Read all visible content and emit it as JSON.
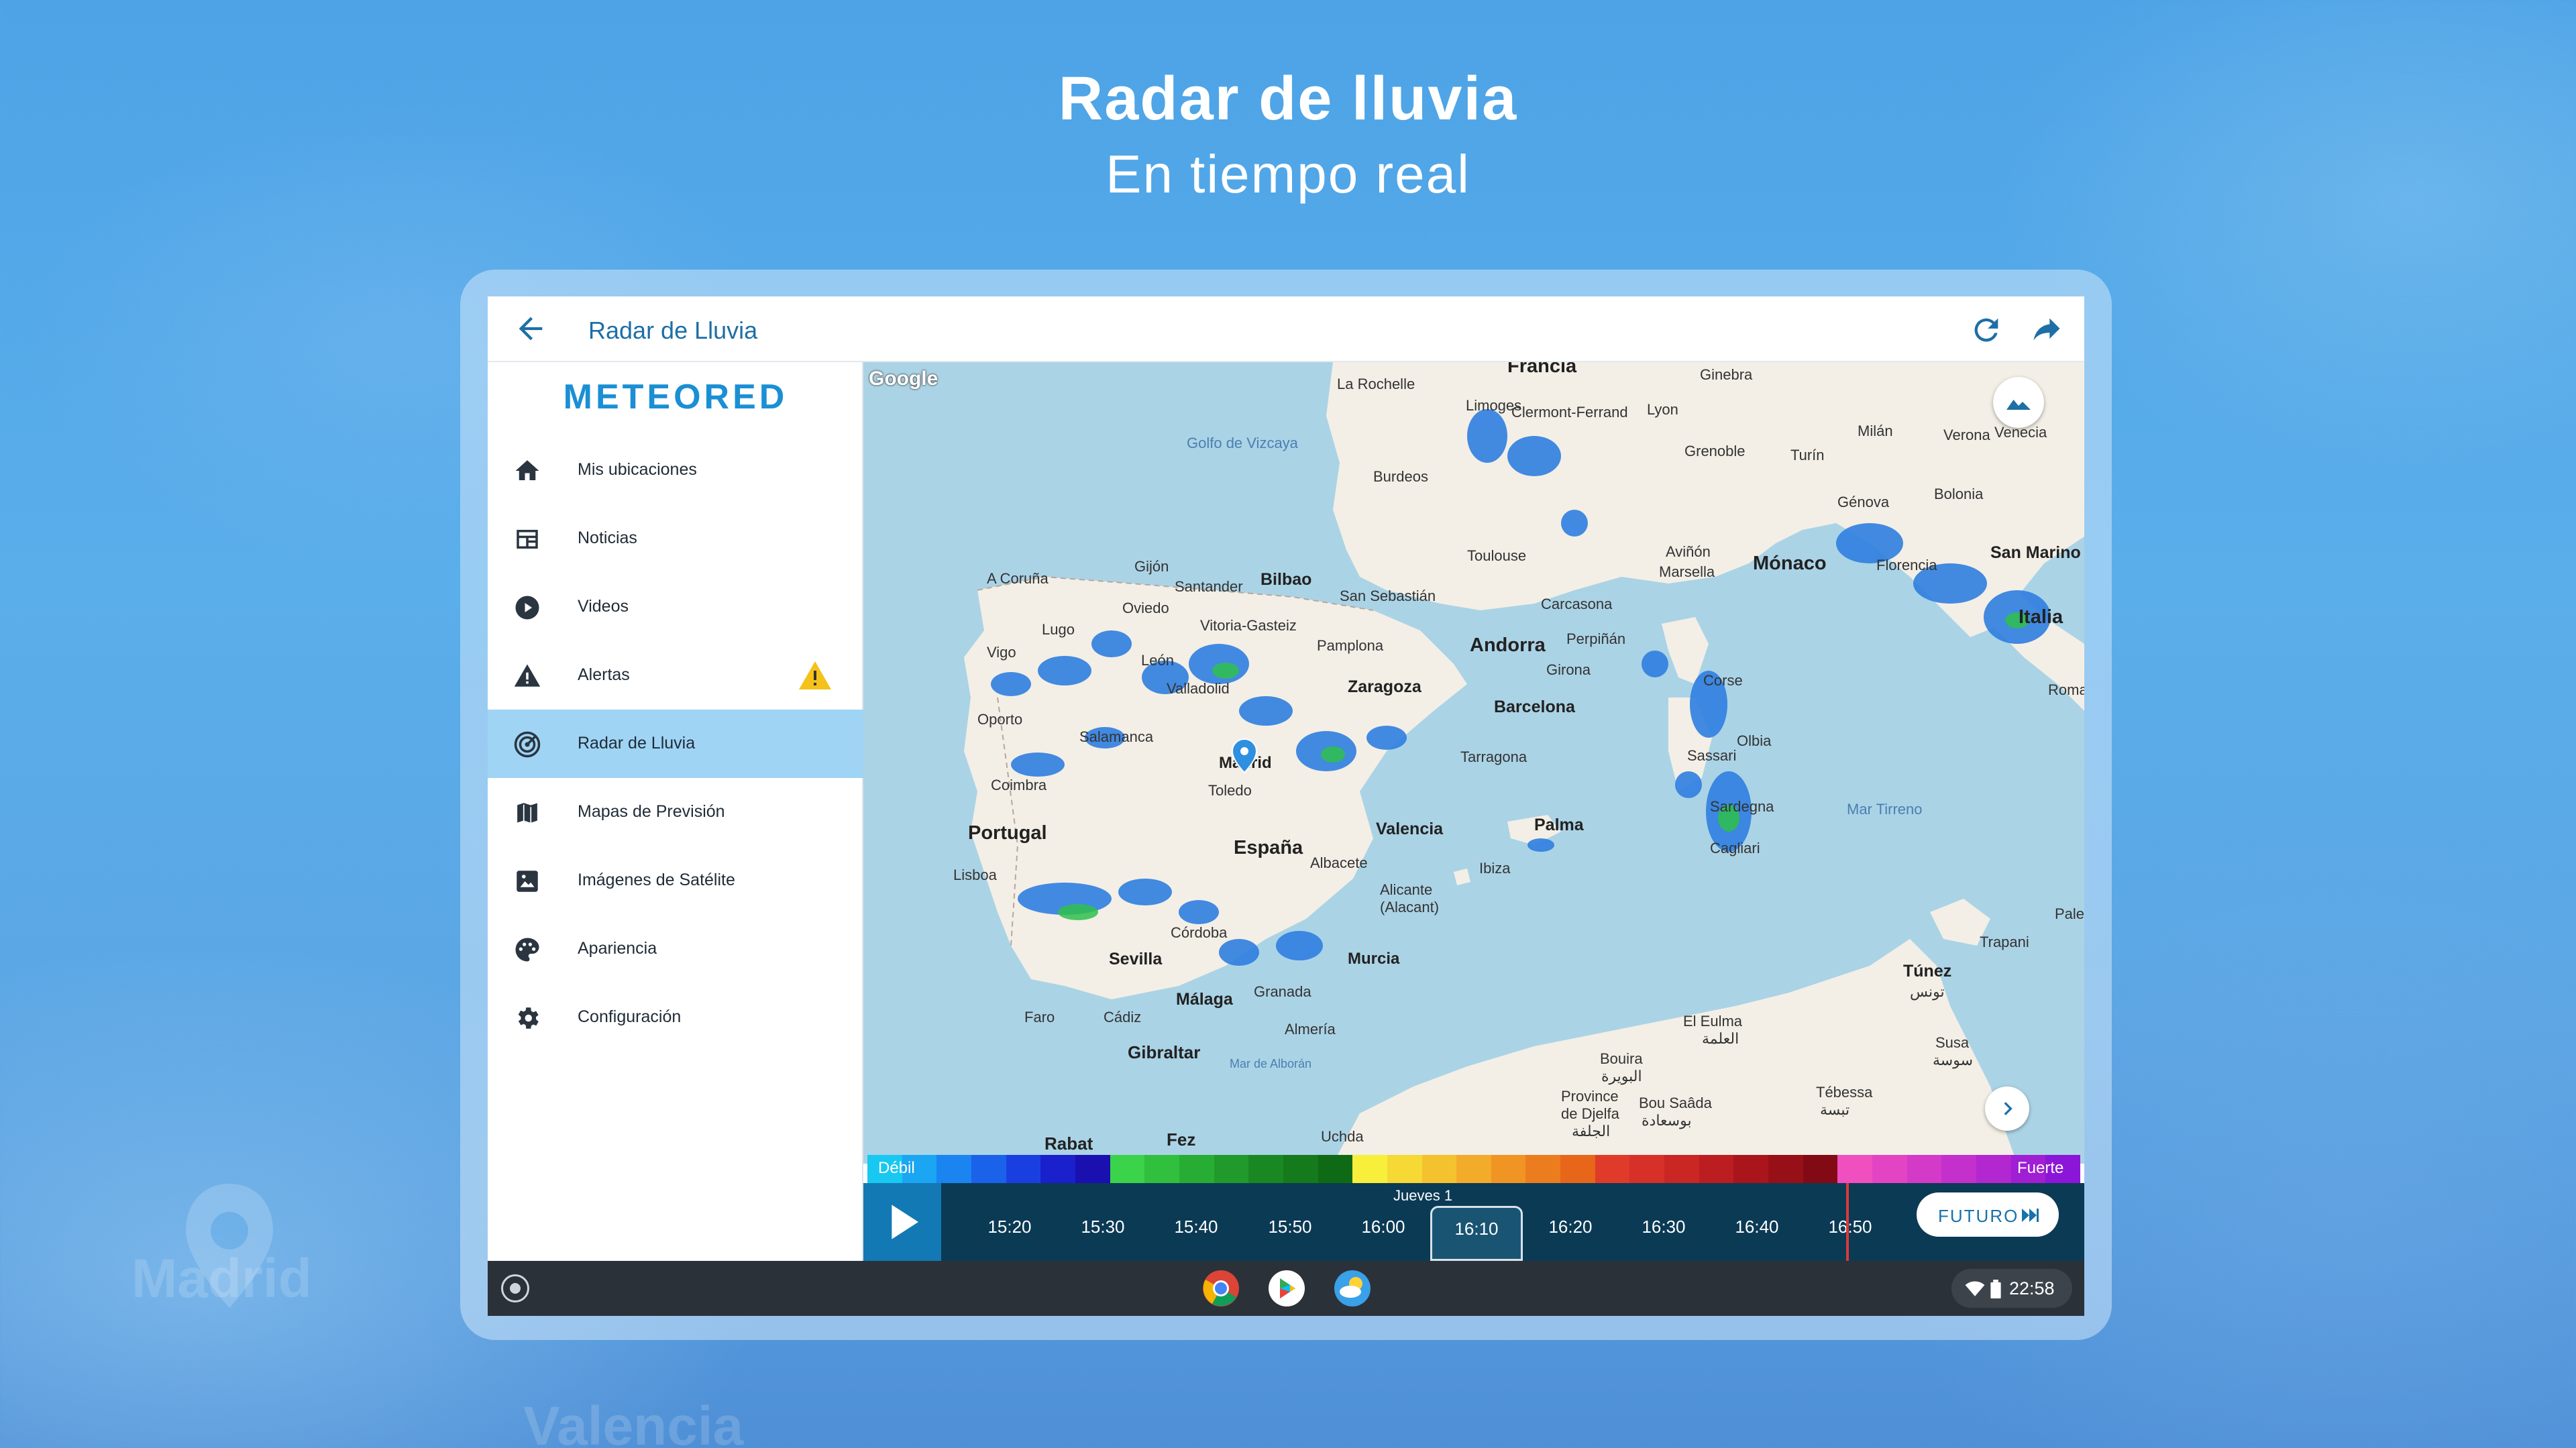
{
  "hero": {
    "title": "Radar de lluvia",
    "subtitle": "En tiempo real"
  },
  "background_labels": {
    "city_1": "Madrid",
    "city_2": "Valencia"
  },
  "colors": {
    "brand": "#1b8fd4",
    "appbar_title": "#1d6fa6",
    "active_item_bg": "#9fd4f4",
    "timeline_bg": "#0b3a55",
    "play_bg": "#1379b5",
    "now_line": "#d93a3a"
  },
  "appbar": {
    "back_icon": "arrow-back-icon",
    "title": "Radar de Lluvia",
    "refresh_icon": "refresh-icon",
    "share_icon": "share-icon"
  },
  "drawer": {
    "logo": "METEORED",
    "items": [
      {
        "label": "Mis ubicaciones",
        "icon": "home-icon"
      },
      {
        "label": "Noticias",
        "icon": "newspaper-icon"
      },
      {
        "label": "Videos",
        "icon": "play-circle-icon"
      },
      {
        "label": "Alertas",
        "icon": "warning-icon",
        "badge": "warning-badge-icon"
      },
      {
        "label": "Radar de Lluvia",
        "icon": "radar-icon",
        "active": true
      },
      {
        "label": "Mapas de Previsión",
        "icon": "map-icon"
      },
      {
        "label": "Imágenes de Satélite",
        "icon": "image-icon"
      },
      {
        "label": "Apariencia",
        "icon": "palette-icon"
      },
      {
        "label": "Configuración",
        "icon": "gear-icon"
      }
    ]
  },
  "map": {
    "attribution": "Google",
    "labels": {
      "francia": "Francia",
      "ginebra": "Ginebra",
      "la_rochelle": "La Rochelle",
      "limoges": "Limoges",
      "clermont": "Clermont-Ferrand",
      "lyon": "Lyon",
      "milan": "Milán",
      "verona": "Verona",
      "venecia": "Venecia",
      "grenoble": "Grenoble",
      "turin": "Turín",
      "golfo": "Golfo de Vizcaya",
      "burdeos": "Burdeos",
      "genova": "Génova",
      "bolonia": "Bolonia",
      "toulouse": "Toulouse",
      "avinon": "Aviñón",
      "marsella": "Marsella",
      "monaco": "Mónaco",
      "florencia": "Florencia",
      "san_marino": "San Marino",
      "coruna": "A Coruña",
      "gijon": "Gijón",
      "santander": "Santander",
      "bilbao": "Bilbao",
      "oviedo": "Oviedo",
      "san_sebastian": "San Sebastián",
      "carcasona": "Carcasona",
      "lugo": "Lugo",
      "vitoria": "Vitoria-Gasteiz",
      "pamplona": "Pamplona",
      "andorra": "Andorra",
      "perpinan": "Perpiñán",
      "italia": "Italia",
      "vigo": "Vigo",
      "leon": "León",
      "girona": "Girona",
      "corse": "Corse",
      "valladolid": "Valladolid",
      "zaragoza": "Zaragoza",
      "barcelona": "Barcelona",
      "roma": "Roma",
      "oporto": "Oporto",
      "salamanca": "Salamanca",
      "olbia": "Olbia",
      "madrid": "Madrid",
      "tarragona": "Tarragona",
      "sassari": "Sassari",
      "coimbra": "Coimbra",
      "toledo": "Toledo",
      "sardegna": "Sardegna",
      "mar_tirreno": "Mar Tirreno",
      "portugal": "Portugal",
      "palma": "Palma",
      "espana": "España",
      "valencia": "Valencia",
      "cagliari": "Cagliari",
      "lisboa": "Lisboa",
      "albacete": "Albacete",
      "ibiza": "Ibiza",
      "alicante": "Alicante\n(Alacant)",
      "cordoba": "Córdoba",
      "palermo": "Pale",
      "trapani": "Trapani",
      "sevilla": "Sevilla",
      "murcia": "Murcia",
      "tunez": "Túnez",
      "tunez_ar": "تونس",
      "malaga": "Málaga",
      "granada": "Granada",
      "faro": "Faro",
      "cadiz": "Cádiz",
      "almeria": "Almería",
      "el_eulma": "El Eulma",
      "el_eulma_ar": "العلمة",
      "sousse": "Susa",
      "sousse_ar": "سوسة",
      "gibraltar": "Gibraltar",
      "mar_alboran": "Mar de Alborán",
      "bouira": "Bouira",
      "bouira_ar": "البويرة",
      "tebessa": "Tébessa",
      "tebessa_ar": "تبسة",
      "djelfa": "Province\nde Djelfa",
      "djelfa_ar": "الجلفة",
      "bou_saada": "Bou Saâda",
      "bou_saada_ar": "بوسعادة",
      "rabat": "Rabat",
      "fez": "Fez",
      "uchda": "Uchda"
    },
    "terrain_icon": "terrain-icon",
    "next_icon": "chevron-right-icon"
  },
  "legend": {
    "weak": "Débil",
    "strong": "Fuerte",
    "colors": [
      "#19c8f0",
      "#1aa6f2",
      "#1a84f0",
      "#1a62ea",
      "#1a3fe0",
      "#1a20cc",
      "#1a10b0",
      "#3ad34a",
      "#30c03e",
      "#27ad33",
      "#209a2a",
      "#1a8822",
      "#157a1c",
      "#0f6a16",
      "#f7ef3a",
      "#f6d935",
      "#f5c22f",
      "#f3ab2a",
      "#f09424",
      "#ec7d1f",
      "#e8661a",
      "#e03a2a",
      "#d63028",
      "#c92624",
      "#bb1d20",
      "#aa151c",
      "#971018",
      "#820a14",
      "#f04fc0",
      "#e344c4",
      "#d43ac8",
      "#c430cc",
      "#b227d0",
      "#a01ed4",
      "#8c16d8"
    ]
  },
  "timeline": {
    "day": "Jueves 1",
    "times": [
      "15:20",
      "15:30",
      "15:40",
      "15:50",
      "16:00",
      "16:10",
      "16:20",
      "16:30",
      "16:40",
      "16:50"
    ],
    "selected": "16:10",
    "future_button": "FUTURO",
    "play_icon": "play-icon",
    "ffwd_icon": "fast-forward-icon"
  },
  "shelf": {
    "launcher_icon": "launcher-icon",
    "apps": [
      "chrome-icon",
      "play-store-icon",
      "weather-app-icon"
    ],
    "wifi_icon": "wifi-icon",
    "battery_icon": "battery-icon",
    "clock": "22:58"
  }
}
